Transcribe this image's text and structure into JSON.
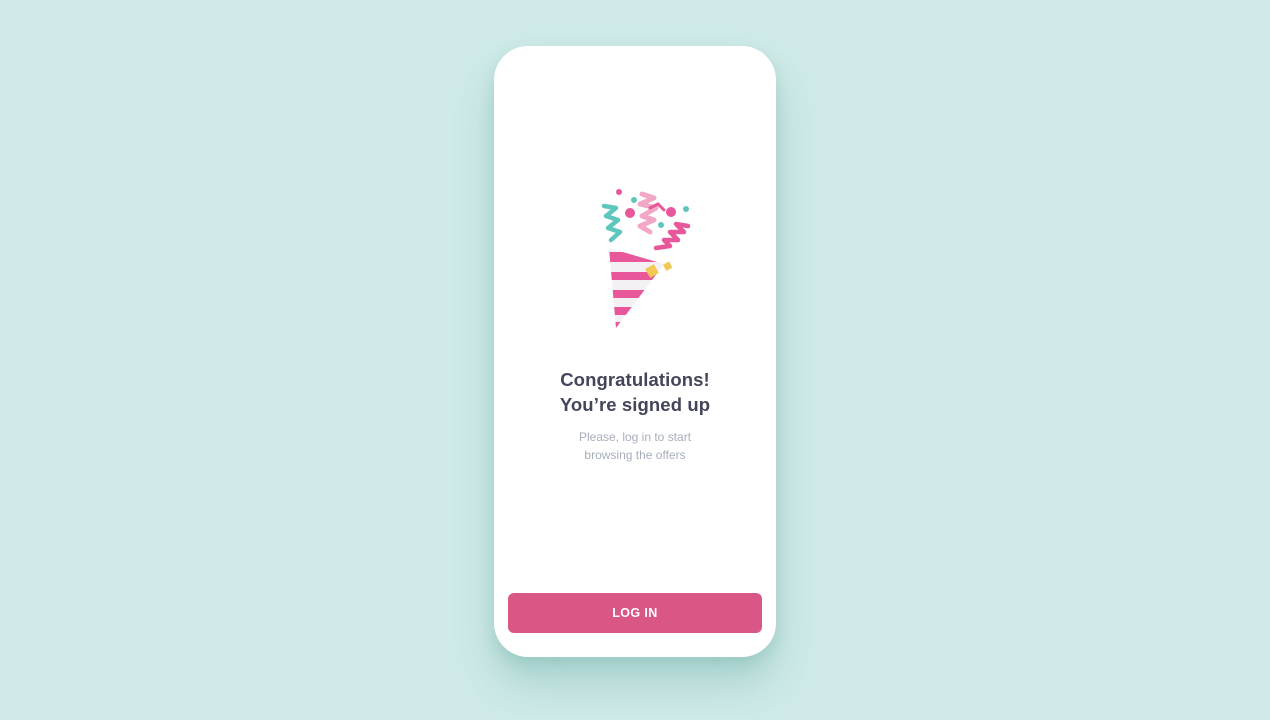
{
  "screen": {
    "headline_line1": "Congratulations!",
    "headline_line2": "You’re signed up",
    "message_line1": "Please, log in to start",
    "message_line2": "browsing the offers",
    "login_button_label": "LOG IN",
    "illustration_icon": "party-popper-icon"
  },
  "colors": {
    "background": "#cfeae8",
    "card": "#ffffff",
    "headline": "#43465a",
    "message": "#a7aebb",
    "button": "#da5686",
    "confetti_pink": "#e7579a",
    "confetti_light_pink": "#f3a7c7",
    "confetti_teal": "#5fc6bd",
    "confetti_yellow": "#f3c956"
  }
}
